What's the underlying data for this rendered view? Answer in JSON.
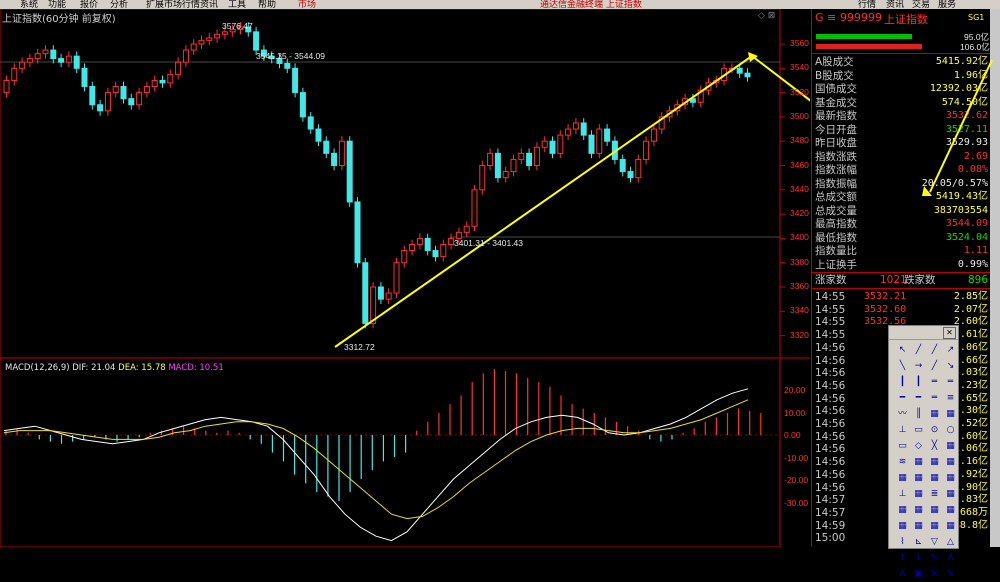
{
  "menu": [
    "系统",
    "功能",
    "报价",
    "分析",
    "扩展市场行情",
    "资讯",
    "工具",
    "帮助"
  ],
  "menu_center": "市场",
  "menu_right_text": "通达信金融终端 上证指数",
  "menu_far_right": [
    "行情",
    "资讯",
    "交易",
    "服务"
  ],
  "chart_title": "上证指数(60分钟 前复权)",
  "title_icons": "◇ ⊠",
  "price_axis": [
    "3560",
    "3540",
    "3520",
    "3500",
    "3480",
    "3460",
    "3440",
    "3420",
    "3400",
    "3380",
    "3360",
    "3340",
    "3320"
  ],
  "macd_axis": [
    "20.00",
    "10.00",
    "0.00",
    "-10.00",
    "-20.00",
    "-30.00"
  ],
  "annotations": {
    "high": "3576.47",
    "line1": "3545.35 - 3544.09",
    "line2": "3401.31 - 3401.43",
    "low": "3312.72"
  },
  "macd": {
    "label": "MACD(12,26,9)",
    "dif": "DIF: 21.04",
    "dea": "DEA: 15.78",
    "macd": "MACD: 10.51"
  },
  "panel": {
    "code_prefix": "G ≡",
    "code": "999999",
    "name": "上证指数",
    "badge": "SG1",
    "bar_vals": [
      "95.0亿",
      "106.0亿"
    ],
    "rows": [
      {
        "label": "A股成交",
        "value": "5415.92亿",
        "color": "yellow"
      },
      {
        "label": "B股成交",
        "value": "1.96亿",
        "color": "yellow"
      },
      {
        "label": "国债成交",
        "value": "12392.03亿",
        "color": "yellow"
      },
      {
        "label": "基金成交",
        "value": "574.50亿",
        "color": "yellow"
      },
      {
        "label": "最新指数",
        "value": "3532.62",
        "color": "red"
      },
      {
        "label": "今日开盘",
        "value": "3527.11",
        "color": "green"
      },
      {
        "label": "昨日收盘",
        "value": "3529.93",
        "color": "white"
      },
      {
        "label": "指数涨跌",
        "value": "2.69",
        "color": "red"
      },
      {
        "label": "指数涨幅",
        "value": "0.08%",
        "color": "red"
      },
      {
        "label": "指数振幅",
        "value": "20.05/0.57%",
        "color": "white"
      },
      {
        "label": "总成交额",
        "value": "5419.43亿",
        "color": "yellow"
      },
      {
        "label": "总成交量",
        "value": "383703554",
        "color": "yellow"
      },
      {
        "label": "最高指数",
        "value": "3544.09",
        "color": "red"
      },
      {
        "label": "最低指数",
        "value": "3524.04",
        "color": "green"
      },
      {
        "label": "指数量比",
        "value": "1.11",
        "color": "red"
      },
      {
        "label": "上证换手",
        "value": "0.99%",
        "color": "white"
      }
    ],
    "updown": {
      "up_label": "涨家数",
      "up": "1021",
      "down_label": "跌家数",
      "down": "896"
    },
    "ticks": [
      {
        "t": "14:55",
        "p": "3532.21",
        "v": "2.85亿"
      },
      {
        "t": "14:55",
        "p": "3532.60",
        "v": "2.07亿"
      },
      {
        "t": "14:55",
        "p": "3532.56",
        "v": "2.60亿"
      },
      {
        "t": "14:55",
        "p": "",
        "v": "2.61亿"
      },
      {
        "t": "14:56",
        "p": "",
        "v": "2.06亿"
      },
      {
        "t": "14:56",
        "p": "",
        "v": "2.66亿"
      },
      {
        "t": "14:56",
        "p": "",
        "v": "3.03亿"
      },
      {
        "t": "14:56",
        "p": "",
        "v": "2.23亿"
      },
      {
        "t": "14:56",
        "p": "",
        "v": "2.65亿"
      },
      {
        "t": "14:56",
        "p": "",
        "v": "3.30亿"
      },
      {
        "t": "14:56",
        "p": "",
        "v": "2.52亿"
      },
      {
        "t": "14:56",
        "p": "",
        "v": "2.60亿"
      },
      {
        "t": "14:56",
        "p": "",
        "v": "1.06亿"
      },
      {
        "t": "14:56",
        "p": "",
        "v": "2.16亿"
      },
      {
        "t": "14:56",
        "p": "",
        "v": "2.92亿"
      },
      {
        "t": "14:56",
        "p": "",
        "v": "1.90亿"
      },
      {
        "t": "14:57",
        "p": "",
        "v": "2.83亿"
      },
      {
        "t": "14:57",
        "p": "",
        "v": "668万"
      },
      {
        "t": "14:59",
        "p": "",
        "v": "88.8亿"
      },
      {
        "t": "15:00",
        "p": "",
        "v": ""
      }
    ]
  },
  "toolbox_glyphs": [
    "↖",
    "╱",
    "╱",
    "↗",
    "╲",
    "→",
    "╱",
    "↘",
    "┃",
    "┃",
    "═",
    "═",
    "━",
    "━",
    "═",
    "≡",
    "〰",
    "║",
    "▦",
    "▦",
    "⊥",
    "▭",
    "⊙",
    "○",
    "▭",
    "◇",
    "╳",
    "▦",
    "≋",
    "▦",
    "▦",
    "▦",
    "▦",
    "▦",
    "▦",
    "▦",
    "⊥",
    "▦",
    "≣",
    "▦",
    "▦",
    "▦",
    "▦",
    "▦",
    "▦",
    "▦",
    "▦",
    "▦",
    "⌇",
    "⊾",
    "▽",
    "△",
    "↑",
    "↓",
    "✎",
    "A",
    "A",
    "▣",
    "✕",
    "✎"
  ],
  "colors": {
    "up": "#ff3030",
    "down": "#40e8e8",
    "trend": "#ffff00",
    "dif": "#ffffff",
    "dea": "#e8e020",
    "grid": "#8b0000",
    "border": "#c00000"
  }
}
